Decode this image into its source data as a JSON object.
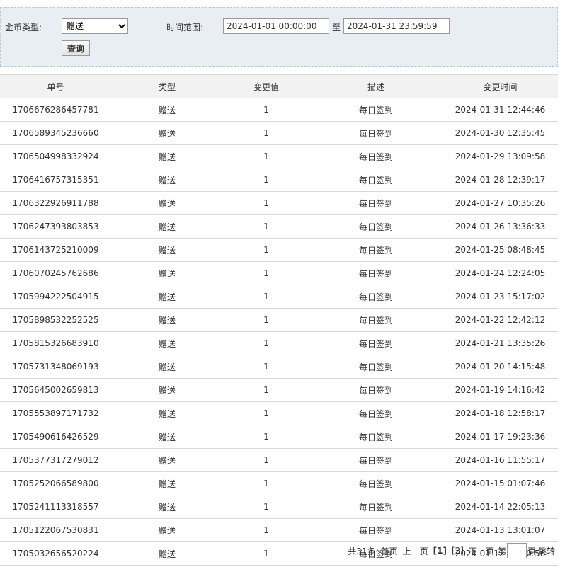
{
  "filter": {
    "coin_type_label": "金币类型:",
    "coin_type_value": "赠送",
    "time_range_label": "时间范围:",
    "start_time": "2024-01-01 00:00:00",
    "to_label": "至",
    "end_time": "2024-01-31 23:59:59",
    "query_button": "查询"
  },
  "table": {
    "headers": [
      "单号",
      "类型",
      "变更值",
      "描述",
      "变更时间"
    ],
    "rows": [
      [
        "1706676286457781",
        "赠送",
        "1",
        "每日签到",
        "2024-01-31 12:44:46"
      ],
      [
        "1706589345236660",
        "赠送",
        "1",
        "每日签到",
        "2024-01-30 12:35:45"
      ],
      [
        "1706504998332924",
        "赠送",
        "1",
        "每日签到",
        "2024-01-29 13:09:58"
      ],
      [
        "1706416757315351",
        "赠送",
        "1",
        "每日签到",
        "2024-01-28 12:39:17"
      ],
      [
        "1706322926911788",
        "赠送",
        "1",
        "每日签到",
        "2024-01-27 10:35:26"
      ],
      [
        "1706247393803853",
        "赠送",
        "1",
        "每日签到",
        "2024-01-26 13:36:33"
      ],
      [
        "1706143725210009",
        "赠送",
        "1",
        "每日签到",
        "2024-01-25 08:48:45"
      ],
      [
        "1706070245762686",
        "赠送",
        "1",
        "每日签到",
        "2024-01-24 12:24:05"
      ],
      [
        "1705994222504915",
        "赠送",
        "1",
        "每日签到",
        "2024-01-23 15:17:02"
      ],
      [
        "1705898532252525",
        "赠送",
        "1",
        "每日签到",
        "2024-01-22 12:42:12"
      ],
      [
        "1705815326683910",
        "赠送",
        "1",
        "每日签到",
        "2024-01-21 13:35:26"
      ],
      [
        "1705731348069193",
        "赠送",
        "1",
        "每日签到",
        "2024-01-20 14:15:48"
      ],
      [
        "1705645002659813",
        "赠送",
        "1",
        "每日签到",
        "2024-01-19 14:16:42"
      ],
      [
        "1705553897171732",
        "赠送",
        "1",
        "每日签到",
        "2024-01-18 12:58:17"
      ],
      [
        "1705490616426529",
        "赠送",
        "1",
        "每日签到",
        "2024-01-17 19:23:36"
      ],
      [
        "1705377317279012",
        "赠送",
        "1",
        "每日签到",
        "2024-01-16 11:55:17"
      ],
      [
        "1705252066589800",
        "赠送",
        "1",
        "每日签到",
        "2024-01-15 01:07:46"
      ],
      [
        "1705241113318557",
        "赠送",
        "1",
        "每日签到",
        "2024-01-14 22:05:13"
      ],
      [
        "1705122067530831",
        "赠送",
        "1",
        "每日签到",
        "2024-01-13 13:01:07"
      ],
      [
        "1705032656520224",
        "赠送",
        "1",
        "每日签到",
        "2024-01-12 12:10:56"
      ]
    ]
  },
  "pager": {
    "total": "共31条",
    "first": "首页",
    "prev": "上一页",
    "current": "[1]",
    "page2": "[2]",
    "next": "下一页",
    "goto_prefix": "第",
    "goto_suffix": "页",
    "jump": "跳转"
  }
}
